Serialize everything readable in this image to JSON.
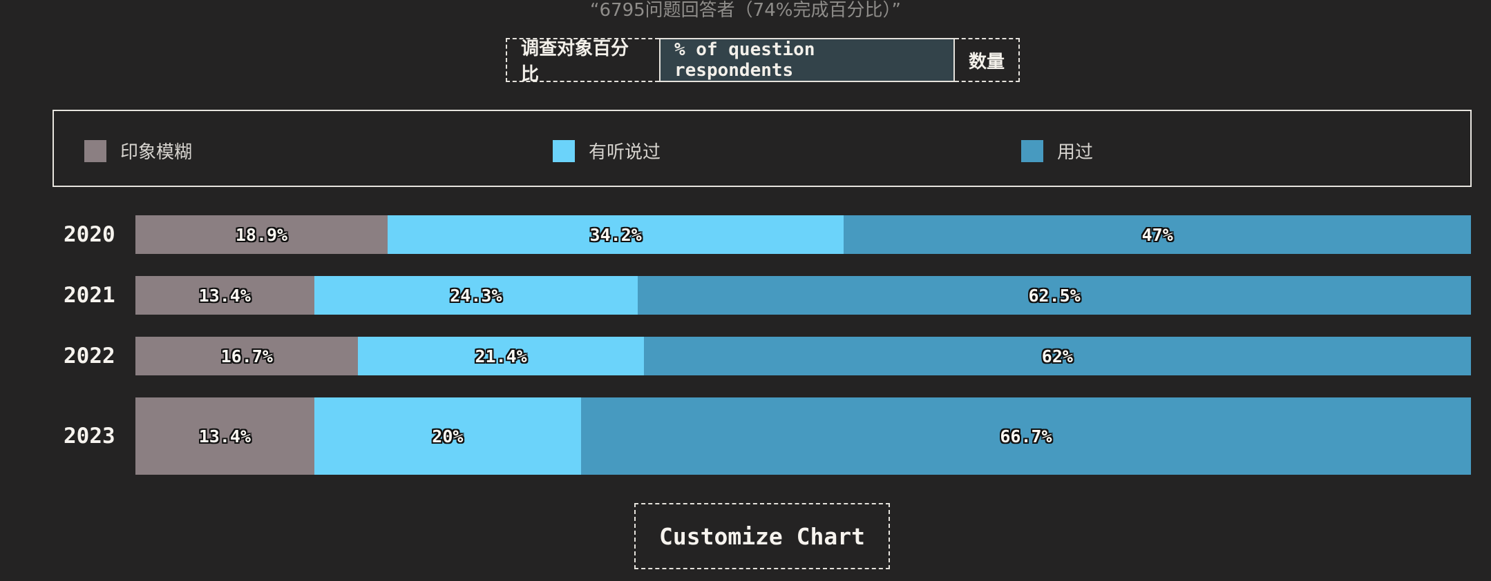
{
  "subtitle": "“6795问题回答者（74%完成百分比）”",
  "toggle": {
    "options": [
      "调查对象百分比",
      "% of question respondents",
      "数量"
    ],
    "selected": "% of question respondents"
  },
  "customize_label": "Customize Chart",
  "colors": {
    "background": "#242323",
    "series": [
      "#8b7f82",
      "#6bd3fa",
      "#479ac0"
    ]
  },
  "chart_data": {
    "type": "bar",
    "orientation": "horizontal",
    "stacked": true,
    "categories": [
      "2020",
      "2021",
      "2022",
      "2023"
    ],
    "series": [
      {
        "name": "印象模糊",
        "color": "#8b7f82",
        "values": [
          18.9,
          13.4,
          16.7,
          13.4
        ],
        "labels": [
          "18.9%",
          "13.4%",
          "16.7%",
          "13.4%"
        ]
      },
      {
        "name": "有听说过",
        "color": "#6bd3fa",
        "values": [
          34.2,
          24.3,
          21.4,
          20
        ],
        "labels": [
          "34.2%",
          "24.3%",
          "21.4%",
          "20%"
        ]
      },
      {
        "name": "用过",
        "color": "#479ac0",
        "values": [
          47,
          62.5,
          62,
          66.7
        ],
        "labels": [
          "47%",
          "62.5%",
          "62%",
          "66.7%"
        ]
      }
    ],
    "legend_position": "top",
    "grid": false,
    "unit": "%"
  }
}
